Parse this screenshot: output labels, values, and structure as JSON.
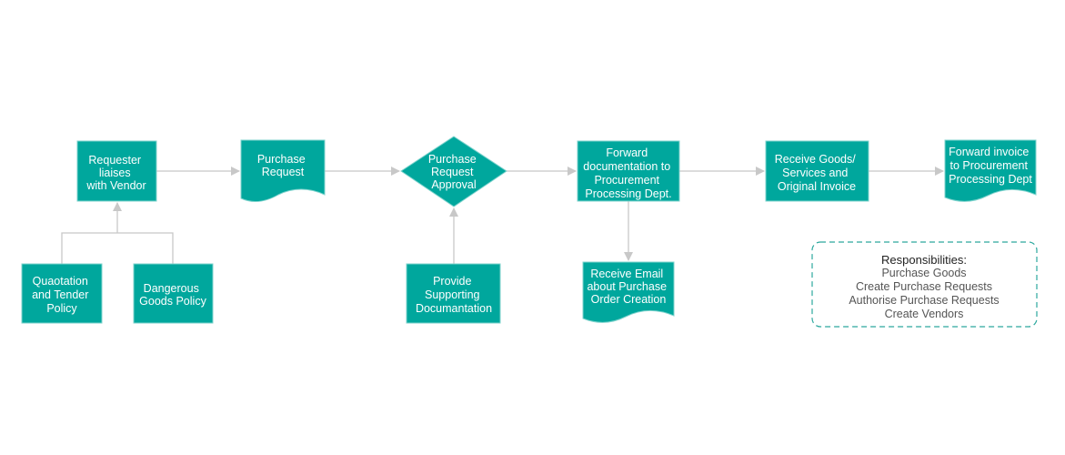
{
  "colors": {
    "node_fill": "#00a79d",
    "connector": "#c8c8c8",
    "responsibility_border": "#2ca89e"
  },
  "nodes": {
    "requester": {
      "shape": "process",
      "lines": [
        "Requester",
        "liaises",
        "with Vendor"
      ]
    },
    "purchase_request": {
      "shape": "document",
      "lines": [
        "Purchase",
        "Request"
      ]
    },
    "approval": {
      "shape": "decision",
      "lines": [
        "Purchase",
        "Request",
        "Approval"
      ]
    },
    "forward_docs": {
      "shape": "process",
      "lines": [
        "Forward",
        "documentation to",
        "Procurement",
        "Processing Dept."
      ]
    },
    "receive_goods": {
      "shape": "process",
      "lines": [
        "Receive Goods/",
        "Services and",
        "Original Invoice"
      ]
    },
    "forward_invoice": {
      "shape": "document",
      "lines": [
        "Forward invoice",
        "to Procurement",
        "Processing Dept"
      ]
    },
    "quotation": {
      "shape": "process",
      "lines": [
        "Quaotation",
        "and Tender",
        "Policy"
      ]
    },
    "dangerous": {
      "shape": "process",
      "lines": [
        "Dangerous",
        "Goods Policy"
      ]
    },
    "supporting": {
      "shape": "process",
      "lines": [
        "Provide",
        "Supporting",
        "Documantation"
      ]
    },
    "receive_email": {
      "shape": "document",
      "lines": [
        "Receive Email",
        "about Purchase",
        "Order Creation"
      ]
    }
  },
  "responsibilities": {
    "title": "Responsibilities:",
    "items": [
      "Purchase Goods",
      "Create Purchase Requests",
      "Authorise Purchase Requests",
      "Create Vendors"
    ]
  }
}
